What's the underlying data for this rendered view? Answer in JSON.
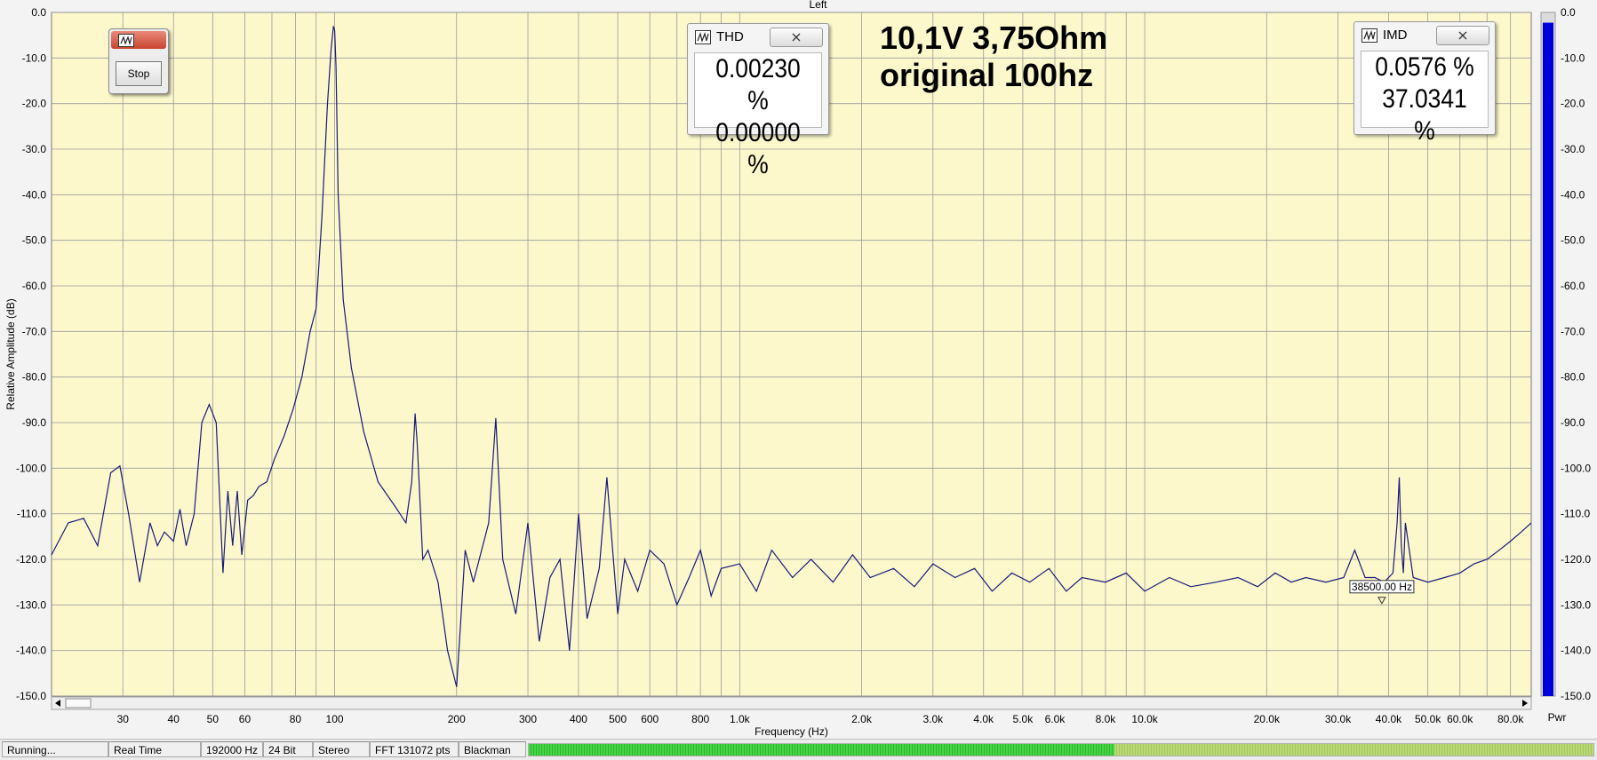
{
  "window": {
    "channel_title": "Left"
  },
  "overlay": {
    "line1": "10,1V 3,75Ohm",
    "line2": "original 100hz"
  },
  "stop_window": {
    "button_label": "Stop"
  },
  "thd_panel": {
    "title": "THD",
    "close_glyph": "⨯",
    "value1": "0.00230 %",
    "value2": "0.00000 %"
  },
  "imd_panel": {
    "title": "IMD",
    "close_glyph": "⨯",
    "value1": "0.0576 %",
    "value2": "37.0341 %"
  },
  "marker": {
    "label": "38500.00 Hz"
  },
  "colors": {
    "plot_bg": "#fcf8cc",
    "trace": "#1a1a7a",
    "grid": "#9a9a9a",
    "meter": "#0000dd",
    "level_green": "#3fd33f"
  },
  "icons": {
    "scroll_left": "triangle-left-icon",
    "scroll_right": "triangle-right-icon",
    "panel": "waveform-icon",
    "close": "close-icon"
  },
  "pwr_meter": {
    "label": "Pwr",
    "level_fraction": 0.985
  },
  "level_bar": {
    "level_fraction": 0.55
  },
  "status_bar": {
    "items": [
      "Running...",
      "Real Time",
      "192000 Hz",
      "24 Bit",
      "Stereo",
      "FFT 131072 pts",
      "Blackman"
    ]
  },
  "chart_data": {
    "type": "line",
    "title": "Left",
    "xlabel": "Frequency (Hz)",
    "ylabel": "Relative Amplitude (dB)",
    "x_scale": "log",
    "xlim": [
      20,
      90000
    ],
    "ylim": [
      -150,
      0
    ],
    "grid": true,
    "x_tick_labels": [
      "30",
      "40",
      "50",
      "60",
      "80",
      "100",
      "200",
      "300",
      "400",
      "500",
      "600",
      "800",
      "1.0k",
      "2.0k",
      "3.0k",
      "4.0k",
      "5.0k",
      "6.0k",
      "8.0k",
      "10.0k",
      "20.0k",
      "30.0k",
      "40.0k",
      "50.0k",
      "60.0k",
      "80.0k"
    ],
    "x_tick_values": [
      30,
      40,
      50,
      60,
      80,
      100,
      200,
      300,
      400,
      500,
      600,
      800,
      1000,
      2000,
      3000,
      4000,
      5000,
      6000,
      8000,
      10000,
      20000,
      30000,
      40000,
      50000,
      60000,
      80000
    ],
    "y_tick_labels": [
      "0.0",
      "-10.0",
      "-20.0",
      "-30.0",
      "-40.0",
      "-50.0",
      "-60.0",
      "-70.0",
      "-80.0",
      "-90.0",
      "-100.0",
      "-110.0",
      "-120.0",
      "-130.0",
      "-140.0",
      "-150.0"
    ],
    "right_y_tick_labels": [
      "0.0",
      "-10.0",
      "-20.0",
      "-30.0",
      "-40.0",
      "-50.0",
      "-60.0",
      "-70.0",
      "-80.0",
      "-90.0",
      "-100.0",
      "-110.0",
      "-120.0",
      "-130.0",
      "-140.0",
      "-150.0"
    ],
    "series": [
      {
        "values_x": [
          20,
          22,
          24,
          26,
          28,
          29.5,
          31,
          33,
          35,
          36.5,
          38,
          40,
          41.5,
          43,
          45,
          47,
          49,
          51,
          53,
          54.5,
          56,
          57.5,
          59,
          61,
          63,
          65,
          68,
          71,
          75,
          79,
          83,
          87,
          90,
          93,
          96,
          98,
          99.3,
          100,
          100.8,
          102,
          105,
          110,
          118,
          128,
          140,
          150,
          155,
          158,
          160,
          165,
          170,
          180,
          190,
          200,
          210,
          220,
          240,
          250,
          260,
          280,
          300,
          320,
          340,
          360,
          380,
          400,
          420,
          450,
          470,
          500,
          520,
          560,
          600,
          650,
          700,
          750,
          800,
          850,
          900,
          1000,
          1100,
          1200,
          1350,
          1500,
          1700,
          1900,
          2100,
          2400,
          2700,
          3000,
          3400,
          3800,
          4200,
          4700,
          5200,
          5800,
          6400,
          7000,
          8000,
          9000,
          10000,
          11500,
          13000,
          15000,
          17000,
          19000,
          21000,
          23000,
          25000,
          28000,
          31000,
          33000,
          35000,
          37000,
          39000,
          41000,
          42000,
          42500,
          43000,
          43500,
          44000,
          46000,
          50000,
          55000,
          60000,
          65000,
          70000,
          75000,
          80000,
          85000,
          90000
        ],
        "values_y": [
          -119,
          -112,
          -111,
          -117,
          -101,
          -99.5,
          -110,
          -125,
          -112,
          -117,
          -114,
          -116,
          -109,
          -117,
          -110,
          -90,
          -86,
          -90,
          -123,
          -105,
          -117,
          -105,
          -119,
          -107,
          -106,
          -104,
          -103,
          -98,
          -93,
          -87,
          -80,
          -70,
          -65,
          -45,
          -20,
          -8,
          -3,
          -4,
          -12,
          -40,
          -63,
          -78,
          -92,
          -103,
          -108,
          -112,
          -103,
          -88,
          -95,
          -120,
          -118,
          -125,
          -140,
          -148,
          -118,
          -125,
          -112,
          -89,
          -120,
          -132,
          -112,
          -138,
          -124,
          -120,
          -140,
          -110,
          -133,
          -122,
          -102,
          -132,
          -120,
          -127,
          -118,
          -121,
          -130,
          -124,
          -118,
          -128,
          -122,
          -121,
          -127,
          -118,
          -124,
          -120,
          -125,
          -119,
          -124,
          -122,
          -126,
          -121,
          -124,
          -122,
          -127,
          -123,
          -125,
          -122,
          -127,
          -124,
          -125,
          -123,
          -127,
          -124,
          -126,
          -125,
          -124,
          -126,
          -123,
          -125,
          -124,
          -125,
          -124,
          -118,
          -124,
          -124,
          -125,
          -123,
          -112,
          -102,
          -117,
          -123,
          -112,
          -124,
          -125,
          -124,
          -123,
          -121,
          -120,
          -118,
          -116,
          -114,
          -112
        ]
      }
    ],
    "meter_label": "Pwr"
  }
}
